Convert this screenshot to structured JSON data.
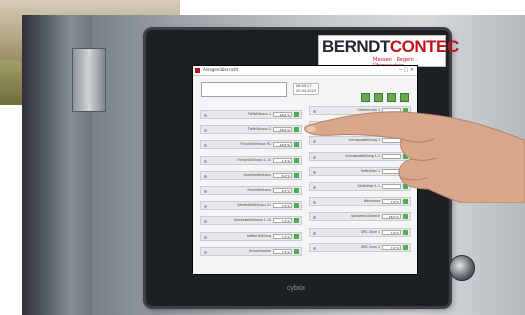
{
  "brand": {
    "name_part1": "BERNDT",
    "name_part2": "CONTEC",
    "tagline": "Messen · Regeln · Überwachen"
  },
  "bezel_logo": "cybox",
  "screen": {
    "app_title": "Anlagenübersicht",
    "window_controls": "‒ □ ✕",
    "search_value": "",
    "datetime_line1": "08:00:27",
    "datetime_line2": "20.04.2023",
    "toolbar_buttons": [
      "home-icon",
      "back-icon",
      "refresh-icon",
      "forward-icon"
    ],
    "left_tiles": [
      {
        "label": "Tiefkühlhaus 1",
        "value": "-18.0°C"
      },
      {
        "label": "Tiefkühlhaus 2",
        "value": "-18.0°C"
      },
      {
        "label": "Fleischkühlhaus R1",
        "value": "-18.0°C"
      },
      {
        "label": "Fleischkühlhaus 1-10",
        "value": "1.5°C"
      },
      {
        "label": "Gemüsekühlhaus",
        "value": "6.0°C"
      },
      {
        "label": "Frischkühlhaus",
        "value": "4.0°C"
      },
      {
        "label": "Getränkekühlhaus 01",
        "value": "7.0°C"
      },
      {
        "label": "Getränkekühlhaus 1-10",
        "value": "7.0°C"
      },
      {
        "label": "Kaffee Kühlung",
        "value": "7.0°C"
      },
      {
        "label": "Schockfroster",
        "value": "7.0°C"
      }
    ],
    "right_tiles": [
      {
        "label": "Gefriertruhe 1",
        "value": ""
      },
      {
        "label": "",
        "value": ""
      },
      {
        "label": "Schnapsabfüllung 1",
        "value": ""
      },
      {
        "label": "Schnapsabfüllung 1-1",
        "value": ""
      },
      {
        "label": "Saftkühler 1",
        "value": ""
      },
      {
        "label": "Saftkühler 1-1",
        "value": ""
      },
      {
        "label": "Weinraum",
        "value": "7.0°C"
      },
      {
        "label": "Speiseeiskühlzelle",
        "value": "-18.0°C"
      },
      {
        "label": "DRC Zone 1",
        "value": "7.0°C"
      },
      {
        "label": "DRC Zone 2",
        "value": "7.0°C"
      }
    ]
  },
  "colors": {
    "brand_red": "#c1121f",
    "brand_dark": "#23282e",
    "status_green": "#4caf50"
  }
}
